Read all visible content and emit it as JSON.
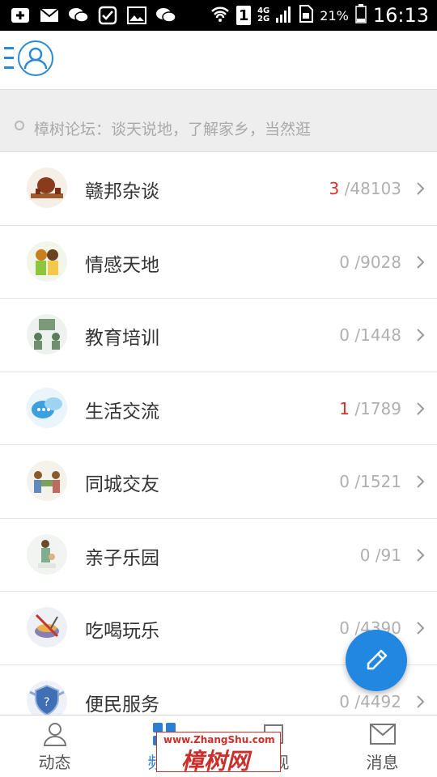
{
  "status_bar": {
    "sim_badge": "1",
    "network_4g": "4G",
    "network_2g": "2G",
    "battery": "21%",
    "time": "16:13"
  },
  "notice": {
    "text": "樟树论坛：谈天说地，了解家乡，当然逛"
  },
  "forums": [
    {
      "name": "赣邦杂谈",
      "new": "3",
      "total": " /48103",
      "icon": "tea-set-icon"
    },
    {
      "name": "情感天地",
      "new": "0",
      "total": " /9028",
      "icon": "couple-icon"
    },
    {
      "name": "教育培训",
      "new": "0",
      "total": " /1448",
      "icon": "classroom-icon"
    },
    {
      "name": "生活交流",
      "new": "1",
      "total": " /1789",
      "icon": "chat-bubbles-icon"
    },
    {
      "name": "同城交友",
      "new": "0",
      "total": " /1521",
      "icon": "friends-icon"
    },
    {
      "name": "亲子乐园",
      "new": "0",
      "total": " /91",
      "icon": "parent-child-icon"
    },
    {
      "name": "吃喝玩乐",
      "new": "0",
      "total": " /4390",
      "icon": "food-icon"
    },
    {
      "name": "便民服务",
      "new": "0",
      "total": " /4492",
      "icon": "shield-icon"
    }
  ],
  "nav": [
    {
      "label": "动态",
      "icon": "user-activity-icon"
    },
    {
      "label": "频道",
      "icon": "grid-icon"
    },
    {
      "label": "发现",
      "icon": "discover-icon"
    },
    {
      "label": "消息",
      "icon": "envelope-icon"
    }
  ],
  "watermark": {
    "url": "www.ZhangShu.com",
    "name": "樟树网"
  },
  "colors": {
    "accent": "#2187e0",
    "new_count": "#d9302a"
  }
}
